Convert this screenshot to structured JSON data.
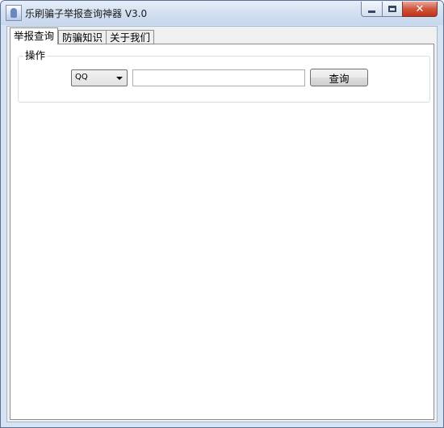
{
  "window": {
    "title": "乐刷骗子举报查询神器 V3.0",
    "controls": {
      "minimize": "–",
      "maximize": "□",
      "close": "✕"
    }
  },
  "tabs": [
    {
      "label": "举报查询",
      "active": true
    },
    {
      "label": "防骗知识",
      "active": false
    },
    {
      "label": "关于我们",
      "active": false
    }
  ],
  "panel": {
    "group_label": "操作",
    "combo_value": "QQ",
    "input_value": "",
    "query_button": "查询"
  },
  "icons": {
    "app": "app-icon",
    "dropdown": "chevron-down-icon"
  }
}
